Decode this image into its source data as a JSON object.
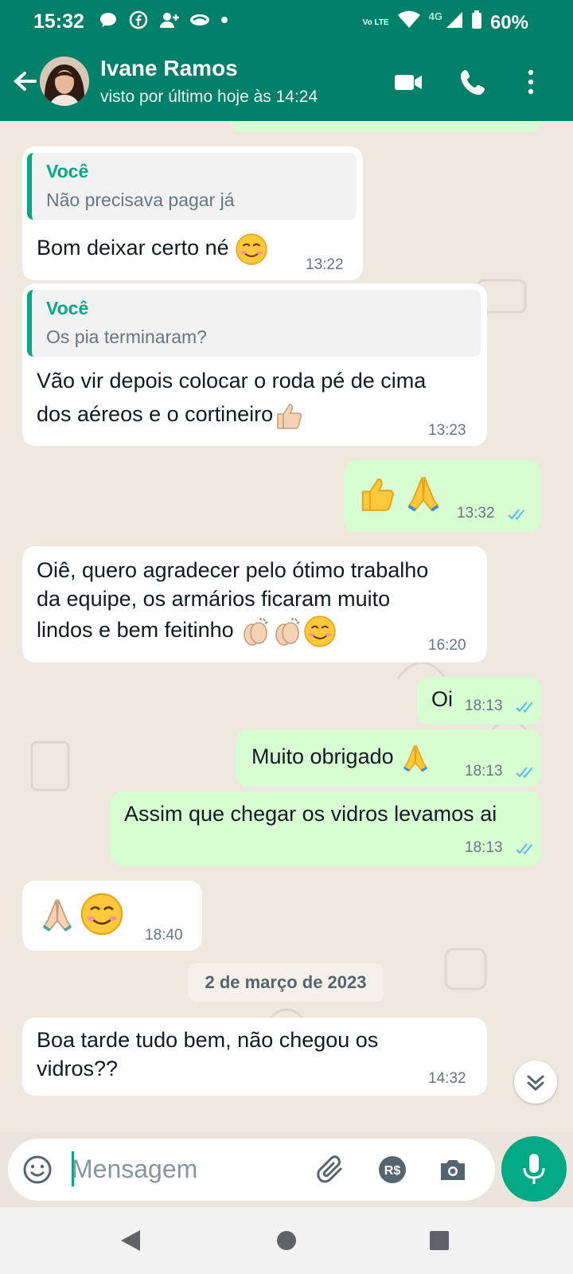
{
  "status_bar": {
    "time": "15:32",
    "volte_label": "Vo LTE",
    "network": "4G",
    "battery": "60%"
  },
  "header": {
    "contact_name": "Ivane Ramos",
    "last_seen": "visto por último hoje às 14:24"
  },
  "messages": [
    {
      "direction": "in",
      "quote_author": "Você",
      "quote_text": "Não precisava pagar já",
      "text": "Bom deixar certo né",
      "time": "13:22"
    },
    {
      "direction": "in",
      "quote_author": "Você",
      "quote_text": "Os pia terminaram?",
      "text_line1": "Vão vir depois colocar o roda pé de cima",
      "text_line2": "dos aéreos e o cortineiro",
      "time": "13:23"
    },
    {
      "direction": "out",
      "text": "",
      "time": "13:32",
      "status": "read"
    },
    {
      "direction": "in",
      "text_line1": "Oiê, quero agradecer pelo ótimo trabalho",
      "text_line2": "da equipe, os armários ficaram muito",
      "text_line3": "lindos e bem feitinho",
      "time": "16:20"
    },
    {
      "direction": "out",
      "text": "Oi",
      "time": "18:13",
      "status": "read"
    },
    {
      "direction": "out",
      "text": "Muito obrigado",
      "time": "18:13",
      "status": "read"
    },
    {
      "direction": "out",
      "text": "Assim que chegar os vidros levamos ai",
      "time": "18:13",
      "status": "read"
    },
    {
      "direction": "in",
      "text": "",
      "time": "18:40"
    },
    {
      "direction": "in",
      "text_line1": "Boa tarde tudo bem, não chegou os",
      "text_line2": "vidros??",
      "time": "14:32"
    }
  ],
  "date_separator": "2 de março de 2023",
  "input": {
    "placeholder": "Mensagem",
    "currency_icon_label": "R$"
  },
  "icons": {
    "back": "arrow-left-icon",
    "video": "video-call-icon",
    "call": "phone-icon",
    "menu": "more-vert-icon",
    "emoji": "emoji-icon",
    "attach": "paperclip-icon",
    "pay": "payment-icon",
    "camera": "camera-icon",
    "mic": "microphone-icon",
    "scroll": "double-chevron-down-icon"
  },
  "colors": {
    "brand": "#008069",
    "accent": "#00a884",
    "outgoing_bubble": "#d9fdd3",
    "incoming_bubble": "#ffffff",
    "read_ticks": "#53bdeb"
  }
}
